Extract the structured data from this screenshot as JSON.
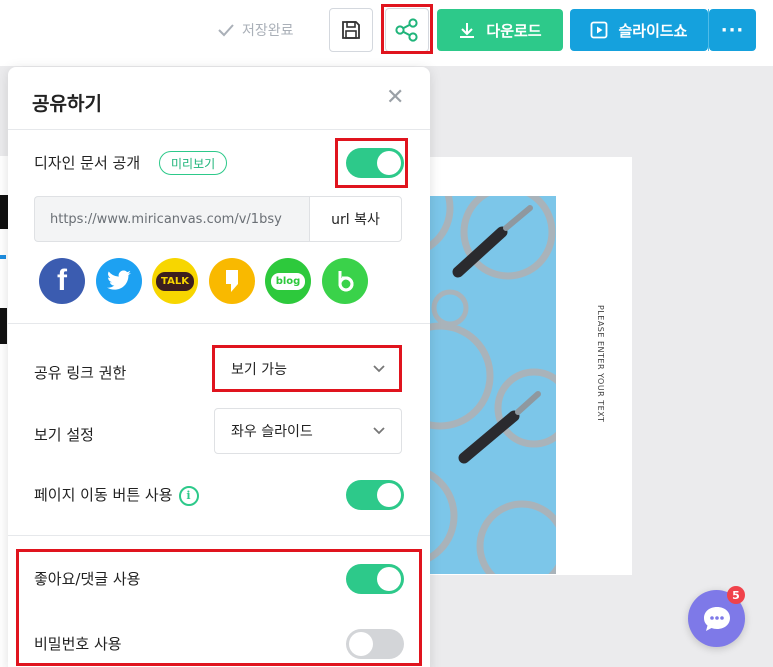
{
  "toolbar": {
    "saved_label": "저장완료",
    "download_label": "다운로드",
    "slideshow_label": "슬라이드쇼",
    "more_label": "···",
    "icons": [
      "check-icon",
      "save-icon",
      "share-icon",
      "download-icon",
      "play-icon",
      "more-icon"
    ],
    "accent_green": "#2dc98a",
    "accent_blue": "#15a1dd"
  },
  "share_panel": {
    "title": "공유하기",
    "close_label": "✕",
    "publish": {
      "label": "디자인 문서 공개",
      "preview_badge": "미리보기",
      "enabled": true
    },
    "url": {
      "value": "https://www.miricanvas.com/v/1bsy",
      "copy_label": "url 복사"
    },
    "sns": {
      "kakao_label": "TALK",
      "blog_label": "blog",
      "icons": [
        "facebook-icon",
        "twitter-icon",
        "kakaotalk-icon",
        "kakaostory-icon",
        "naver-blog-icon",
        "band-icon"
      ]
    },
    "permission": {
      "label": "공유 링크 권한",
      "value": "보기 가능"
    },
    "view_setting": {
      "label": "보기 설정",
      "value": "좌우 슬라이드"
    },
    "page_nav": {
      "label": "페이지 이동 버튼 사용",
      "info_icon": "i",
      "enabled": true
    },
    "like_comment": {
      "label": "좋아요/댓글 사용",
      "enabled": true
    },
    "password": {
      "label": "비밀번호 사용",
      "enabled": false
    }
  },
  "slide": {
    "vertical_text": "PLEASE ENTER YOUR TEXT"
  },
  "chat": {
    "badge_count": "5"
  }
}
